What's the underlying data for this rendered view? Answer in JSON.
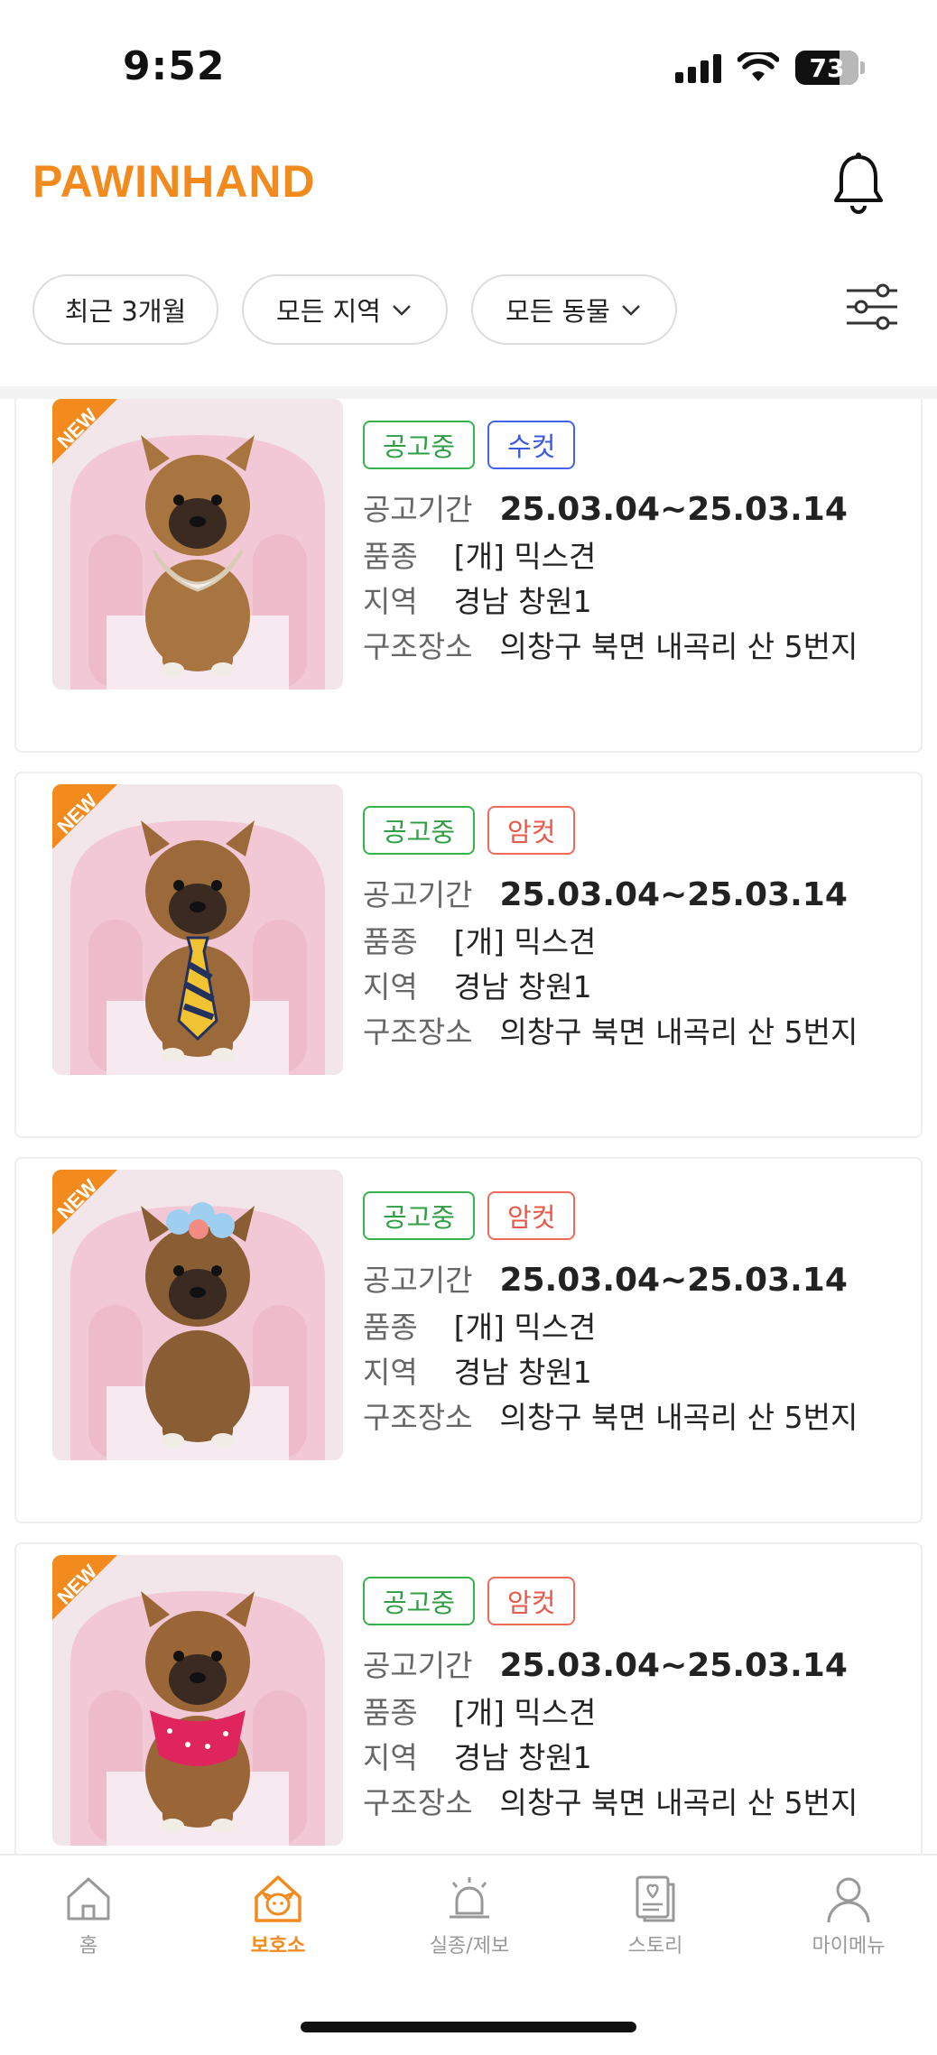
{
  "status_bar": {
    "time": "9:52",
    "battery": "73"
  },
  "header": {
    "logo": "PAWINHAND"
  },
  "filters": [
    {
      "label": "최근 3개월",
      "has_dropdown": false
    },
    {
      "label": "모든 지역",
      "has_dropdown": true
    },
    {
      "label": "모든 동물",
      "has_dropdown": true
    }
  ],
  "card_labels": {
    "period": "공고기간",
    "breed": "품종",
    "region": "지역",
    "rescue_place": "구조장소"
  },
  "cards": [
    {
      "new_tag": "NEW",
      "status": "공고중",
      "sex": "수컷",
      "sex_type": "male",
      "period": "25.03.04~25.03.14",
      "breed": "[개] 믹스견",
      "region": "경남 창원1",
      "rescue_place": "의창구 북면 내곡리 산 5번지",
      "accessory": "bib"
    },
    {
      "new_tag": "NEW",
      "status": "공고중",
      "sex": "암컷",
      "sex_type": "female",
      "period": "25.03.04~25.03.14",
      "breed": "[개] 믹스견",
      "region": "경남 창원1",
      "rescue_place": "의창구 북면 내곡리 산 5번지",
      "accessory": "tie"
    },
    {
      "new_tag": "NEW",
      "status": "공고중",
      "sex": "암컷",
      "sex_type": "female",
      "period": "25.03.04~25.03.14",
      "breed": "[개] 믹스견",
      "region": "경남 창원1",
      "rescue_place": "의창구 북면 내곡리 산 5번지",
      "accessory": "flower"
    },
    {
      "new_tag": "NEW",
      "status": "공고중",
      "sex": "암컷",
      "sex_type": "female",
      "period": "25.03.04~25.03.14",
      "breed": "[개] 믹스견",
      "region": "경남 창원1",
      "rescue_place": "의창구 북면 내곡리 산 5번지",
      "accessory": "scarf"
    }
  ],
  "nav": [
    {
      "label": "홈",
      "icon": "home-icon",
      "active": false
    },
    {
      "label": "보호소",
      "icon": "shelter-icon",
      "active": true
    },
    {
      "label": "실종/제보",
      "icon": "alarm-icon",
      "active": false
    },
    {
      "label": "스토리",
      "icon": "story-icon",
      "active": false
    },
    {
      "label": "마이메뉴",
      "icon": "person-icon",
      "active": false
    }
  ],
  "colors": {
    "brand": "#F28A1E",
    "status_green": "#2f9e44",
    "male_blue": "#3b5bdb",
    "female_red": "#e8594a"
  }
}
